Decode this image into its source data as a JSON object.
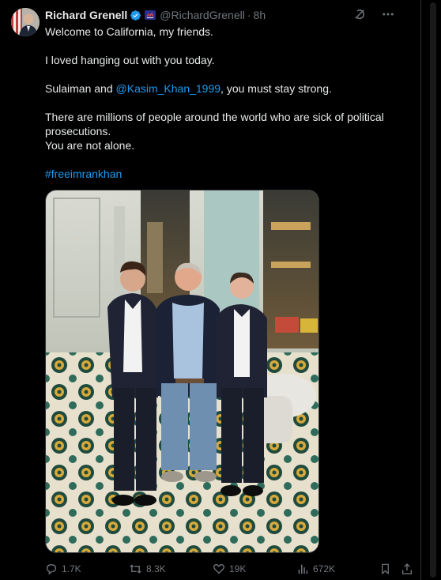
{
  "tweet": {
    "author": {
      "display_name": "Richard Grenell",
      "handle": "@RichardGrenell",
      "verified": true,
      "verified_color": "#1d9bf0",
      "avatar_icon": "avatar-photo"
    },
    "separator": "·",
    "time": "8h",
    "paragraphs": [
      {
        "text": "Welcome to California, my friends."
      },
      {
        "text": "I loved hanging out with you today."
      },
      {
        "before": "Sulaiman and ",
        "mention": "@Kasim_Khan_1999",
        "after": ", you must stay strong."
      },
      {
        "line1": "There are millions of people around the world who are sick of political prosecutions.",
        "line2": "You are not alone."
      },
      {
        "hashtag": "#freeimrankhan"
      }
    ],
    "link_color": "#1d9bf0",
    "media": {
      "type": "photo",
      "icon": "photo-of-three-men"
    },
    "stats": {
      "replies": "1.7K",
      "reposts": "8.3K",
      "likes": "19K",
      "views": "672K"
    }
  },
  "icons": {
    "grok": "grok-icon",
    "more": "more-icon",
    "reply": "reply-icon",
    "repost": "repost-icon",
    "like": "like-icon",
    "views": "views-icon",
    "bookmark": "bookmark-icon",
    "share": "share-icon"
  }
}
